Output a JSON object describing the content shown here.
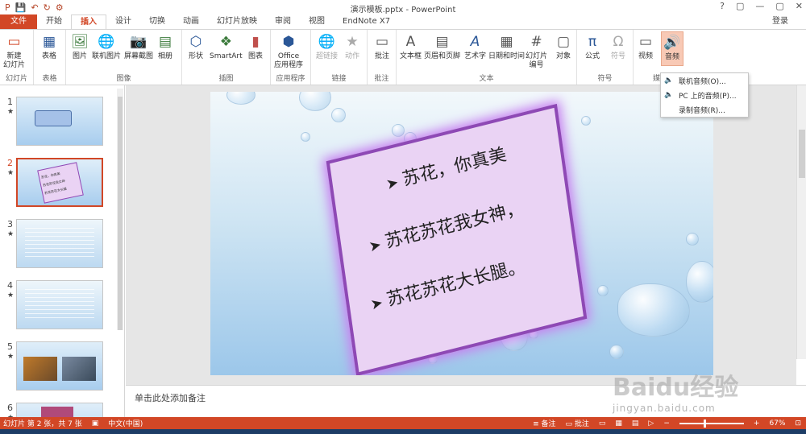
{
  "window": {
    "title": "演示模板.pptx - PowerPoint",
    "controls": [
      "?",
      "▢",
      "—",
      "▢",
      "✕"
    ]
  },
  "qat": {
    "save": "💾",
    "undo": "↶",
    "redo": "↻",
    "extra": "⚙"
  },
  "tabs": [
    "文件",
    "开始",
    "插入",
    "设计",
    "切换",
    "动画",
    "幻灯片放映",
    "审阅",
    "视图",
    "EndNote X7"
  ],
  "active_tab": "插入",
  "login": "登录",
  "ribbon": {
    "groups": [
      {
        "label": "幻灯片",
        "buttons": [
          {
            "label": "新建\n幻灯片",
            "icon": "new-slide-icon"
          }
        ]
      },
      {
        "label": "表格",
        "buttons": [
          {
            "label": "表格",
            "icon": "table-icon"
          }
        ]
      },
      {
        "label": "图像",
        "buttons": [
          {
            "label": "图片",
            "icon": "picture-icon"
          },
          {
            "label": "联机图片",
            "icon": "online-picture-icon"
          },
          {
            "label": "屏幕截图",
            "icon": "screenshot-icon"
          },
          {
            "label": "相册",
            "icon": "album-icon"
          }
        ]
      },
      {
        "label": "插图",
        "buttons": [
          {
            "label": "形状",
            "icon": "shapes-icon"
          },
          {
            "label": "SmartArt",
            "icon": "smartart-icon"
          },
          {
            "label": "图表",
            "icon": "chart-icon"
          }
        ]
      },
      {
        "label": "应用程序",
        "buttons": [
          {
            "label": "Office\n应用程序",
            "icon": "office-icon"
          }
        ]
      },
      {
        "label": "链接",
        "buttons": [
          {
            "label": "超链接",
            "icon": "hyperlink-icon"
          },
          {
            "label": "动作",
            "icon": "action-icon"
          }
        ]
      },
      {
        "label": "批注",
        "buttons": [
          {
            "label": "批注",
            "icon": "comment-icon"
          }
        ]
      },
      {
        "label": "文本",
        "buttons": [
          {
            "label": "文本框",
            "icon": "textbox-icon"
          },
          {
            "label": "页眉和页脚",
            "icon": "header-footer-icon"
          },
          {
            "label": "艺术字",
            "icon": "wordart-icon"
          },
          {
            "label": "日期和时间",
            "icon": "date-time-icon"
          },
          {
            "label": "幻灯片\n编号",
            "icon": "slide-number-icon"
          },
          {
            "label": "对象",
            "icon": "object-icon"
          }
        ]
      },
      {
        "label": "符号",
        "buttons": [
          {
            "label": "公式",
            "icon": "equation-icon"
          },
          {
            "label": "符号",
            "icon": "symbol-icon"
          }
        ]
      },
      {
        "label": "媒",
        "buttons": [
          {
            "label": "视频",
            "icon": "video-icon"
          },
          {
            "label": "音频",
            "icon": "audio-icon"
          }
        ]
      }
    ]
  },
  "audio_menu": [
    "联机音频(O)...",
    "PC 上的音频(P)...",
    "录制音频(R)..."
  ],
  "thumbnails": [
    {
      "num": "1",
      "star": "★"
    },
    {
      "num": "2",
      "star": "★"
    },
    {
      "num": "3",
      "star": "★"
    },
    {
      "num": "4",
      "star": "★"
    },
    {
      "num": "5",
      "star": "★"
    },
    {
      "num": "6",
      "star": "★"
    }
  ],
  "active_slide": "2",
  "thumb2_lines": [
    "苏花，你真美",
    "苏花苏花我女神",
    "苏花苏花大长腿"
  ],
  "slide_text": {
    "line1": "苏花，你真美",
    "line2": "苏花苏花我女神，",
    "line3": "苏花苏花大长腿。",
    "bullet": "➤"
  },
  "notes": "单击此处添加备注",
  "status": {
    "slide_info": "幻灯片 第 2 张，共 7 张",
    "language": "中文(中国)",
    "notes_btn": "备注",
    "comments_btn": "批注",
    "zoom": "67%"
  },
  "watermark": {
    "logo": "Baidu经验",
    "url": "jingyan.baidu.com"
  },
  "colors": {
    "accent": "#d24726",
    "card_border": "#8e49b5",
    "card_fill": "#ead3f4"
  }
}
